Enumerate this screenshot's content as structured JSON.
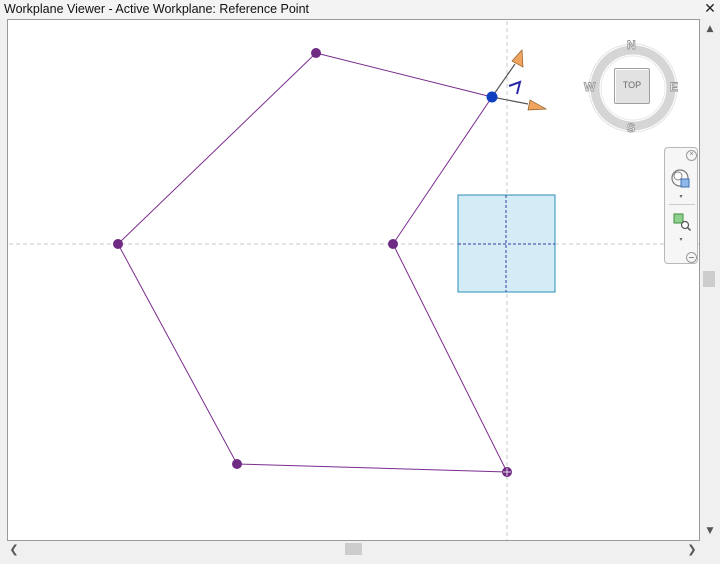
{
  "window": {
    "title": "Workplane Viewer - Active Workplane: Reference Point",
    "close_glyph": "✕"
  },
  "viewcube": {
    "face_label": "TOP",
    "compass": {
      "north": "N",
      "south": "S",
      "east": "E",
      "west": "W"
    }
  },
  "navigation_bar": {
    "close_glyph": "×",
    "arrow_glyph": "▾",
    "tools": [
      "steering-wheel",
      "zoom-region"
    ]
  },
  "scrollbars": {
    "up_glyph": "▲",
    "down_glyph": "▼",
    "left_glyph": "❮",
    "right_glyph": "❯"
  },
  "colors": {
    "line": "#7b2d8e",
    "vertex": "#6f2a83",
    "selected_point": "#1040c0",
    "workplane_fill": "#d4ecf5",
    "workplane_border": "#2a8fb8",
    "gizmo_arrow": "#f0a460"
  }
}
